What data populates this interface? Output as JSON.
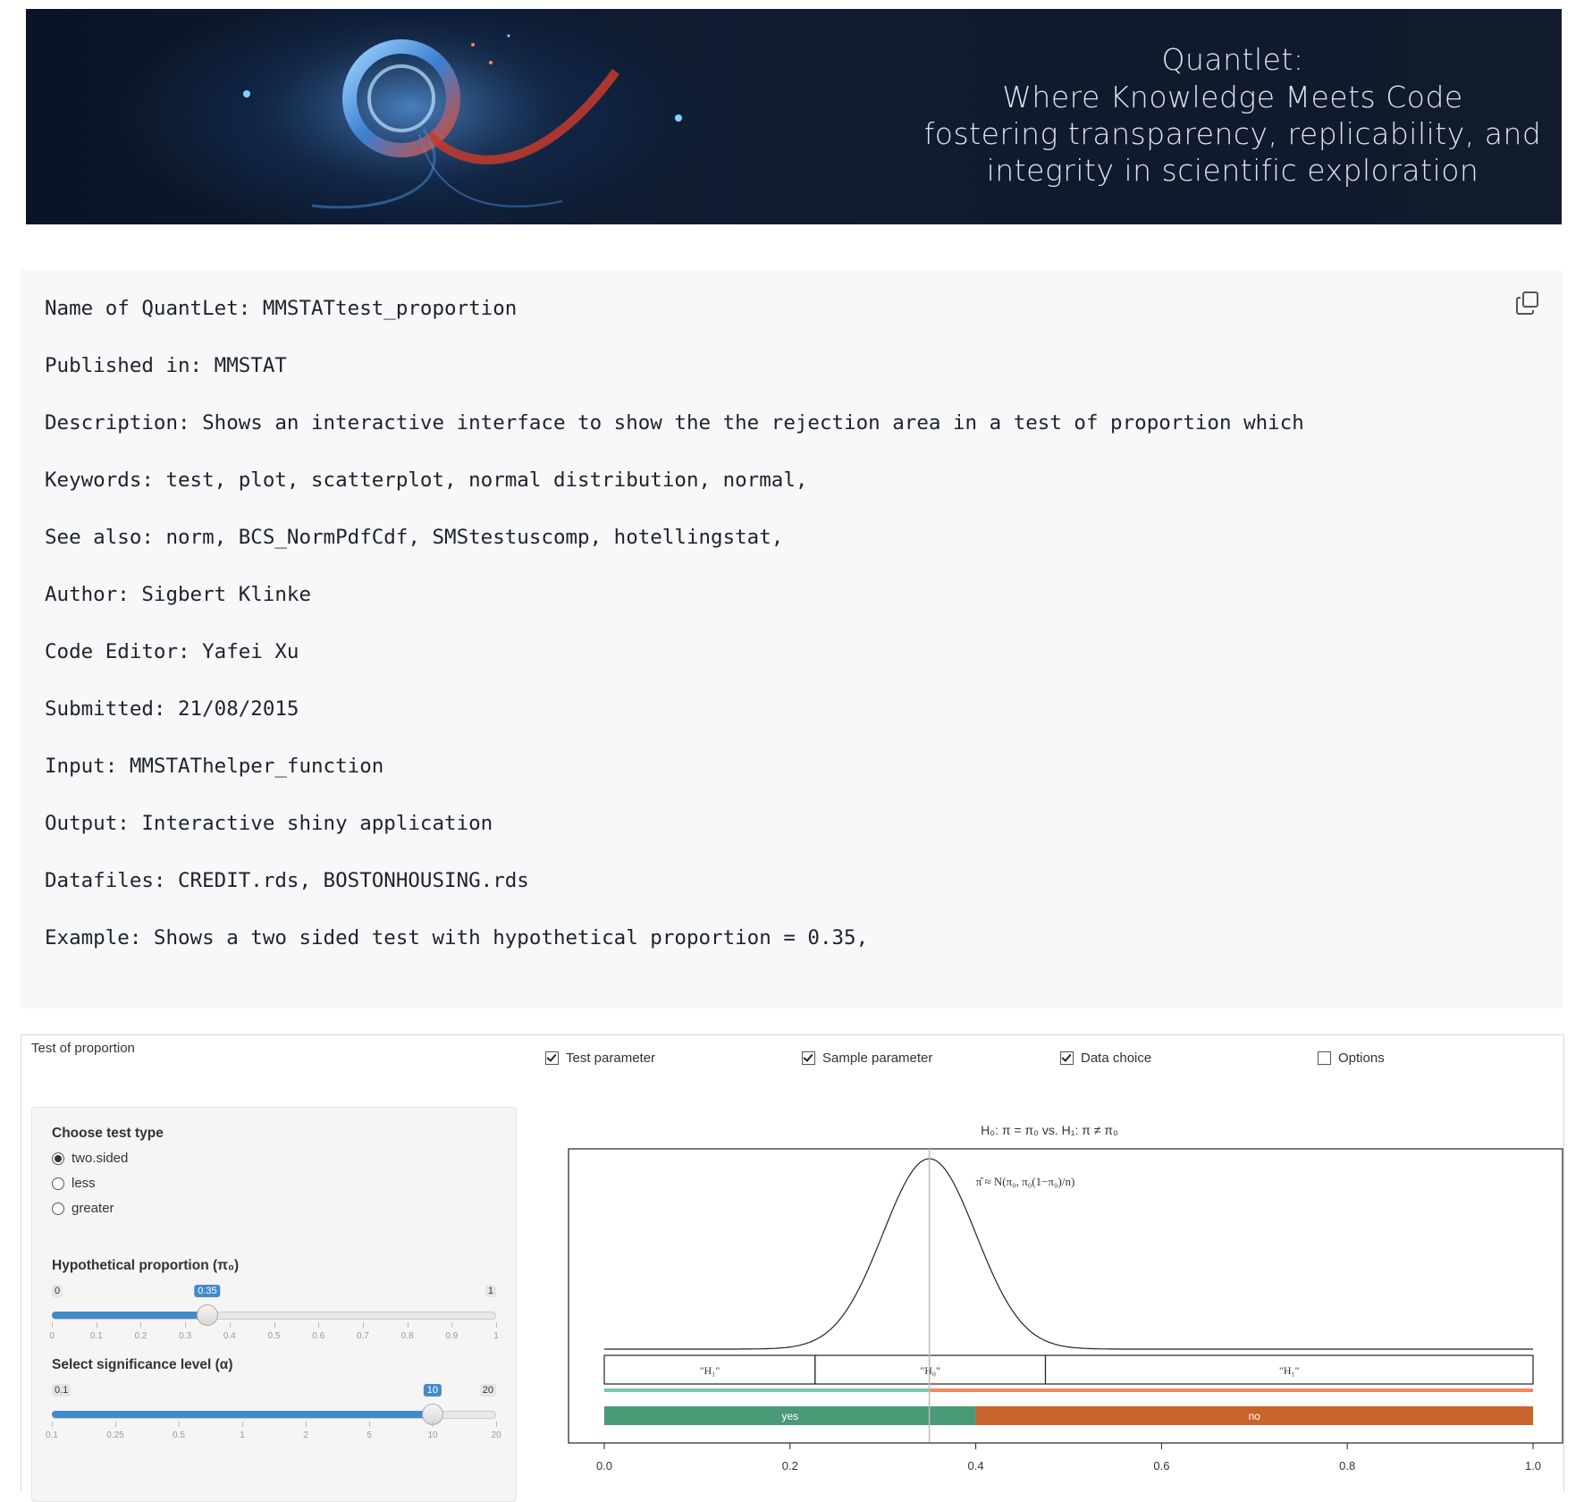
{
  "banner": {
    "line1": "Quantlet:",
    "line2": "Where Knowledge Meets Code",
    "line3": "fostering transparency, replicability, and",
    "line4": "integrity in scientific exploration"
  },
  "meta": {
    "lines": [
      "Name of QuantLet: MMSTATtest_proportion",
      "Published in: MMSTAT",
      "Description: Shows an interactive interface to show the the rejection area in a test of proportion which",
      "Keywords: test, plot, scatterplot, normal distribution, normal,",
      "See also: norm, BCS_NormPdfCdf, SMStestuscomp, hotellingstat,",
      "Author: Sigbert Klinke",
      "Code Editor: Yafei Xu",
      "Submitted: 21/08/2015",
      "Input: MMSTAThelper_function",
      "Output: Interactive shiny application",
      "Datafiles: CREDIT.rds, BOSTONHOUSING.rds",
      "Example: Shows a two sided test with hypothetical proportion = 0.35,"
    ]
  },
  "app": {
    "title": "Test of proportion",
    "toggles": [
      {
        "label": "Test parameter",
        "checked": true
      },
      {
        "label": "Sample parameter",
        "checked": true
      },
      {
        "label": "Data choice",
        "checked": true
      },
      {
        "label": "Options",
        "checked": false
      }
    ],
    "test_type": {
      "label": "Choose test type",
      "options": [
        "two.sided",
        "less",
        "greater"
      ],
      "selected": "two.sided"
    },
    "prop_slider": {
      "label": "Hypothetical proportion (π₀)",
      "min": "0",
      "max": "1",
      "value": "0.35",
      "value_num": 0.35,
      "ticks": [
        "0",
        "0.1",
        "0.2",
        "0.3",
        "0.4",
        "0.5",
        "0.6",
        "0.7",
        "0.8",
        "0.9",
        "1"
      ]
    },
    "sig_slider": {
      "label": "Select significance level (α)",
      "min": "0.1",
      "max": "20",
      "value": "10",
      "fraction": 0.857,
      "ticks": [
        "0.1",
        "0.25",
        "0.5",
        "1",
        "2",
        "5",
        "10",
        "20"
      ]
    }
  },
  "chart_data": {
    "type": "line",
    "title": "H₀: π = π₀ vs. H₁: π ≠ π₀",
    "annotation": "π̂ ≈ N(π₀, π₀(1−π₀)/n)",
    "mean": 0.35,
    "sd": 0.05,
    "xlim": [
      0,
      1
    ],
    "x_ticks": [
      "0.0",
      "0.2",
      "0.4",
      "0.6",
      "0.8",
      "1.0"
    ],
    "regions": [
      {
        "label": "\"H₁\"",
        "from": 0,
        "to": 0.227
      },
      {
        "label": "\"H₀\"",
        "from": 0.227,
        "to": 0.475
      },
      {
        "label": "\"H₁\"",
        "from": 0.475,
        "to": 1.0
      }
    ],
    "decision": [
      {
        "label": "yes",
        "from": 0,
        "to": 0.4,
        "color": "#4a9a78"
      },
      {
        "label": "no",
        "from": 0.4,
        "to": 1.0,
        "color": "#c8632b"
      }
    ],
    "thin_bar": [
      {
        "from": 0,
        "to": 0.35,
        "color": "#7cc7a7"
      },
      {
        "from": 0.35,
        "to": 1.0,
        "color": "#f08a5d"
      }
    ]
  }
}
